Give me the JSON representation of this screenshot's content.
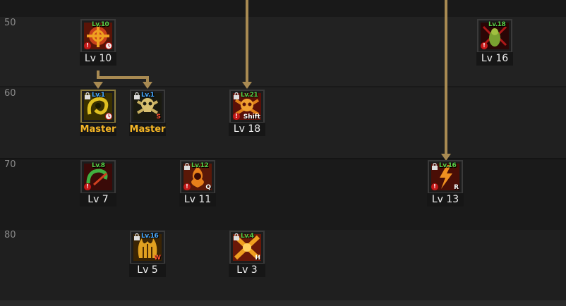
{
  "rows": [
    {
      "label": "50"
    },
    {
      "label": "60"
    },
    {
      "label": "70"
    },
    {
      "label": "80"
    }
  ],
  "skills": [
    {
      "id": "skill-a",
      "level_req": "Lv.10",
      "level_label": "Lv 10",
      "hotkey": "",
      "icon": "crosshair-skill-icon",
      "accent": "#d83a1a"
    },
    {
      "id": "skill-b",
      "level_req": "Lv.18",
      "level_label": "Lv 16",
      "hotkey": "",
      "icon": "dark-figure-skill-icon",
      "accent": "#8a1a1a"
    },
    {
      "id": "skill-c",
      "level_req": "Lv.1",
      "level_label": "Master",
      "hotkey": "",
      "icon": "swirl-skill-icon",
      "accent": "#b89a20"
    },
    {
      "id": "skill-d",
      "level_req": "Lv.1",
      "level_label": "Master",
      "hotkey": "S",
      "icon": "skull-skill-icon",
      "accent": "#b8a040"
    },
    {
      "id": "skill-e",
      "level_req": "Lv.21",
      "level_label": "Lv 18",
      "hotkey": "Shift",
      "icon": "skull-fire-skill-icon",
      "accent": "#c03a1a"
    },
    {
      "id": "skill-f",
      "level_req": "Lv.8",
      "level_label": "Lv 7",
      "hotkey": "",
      "icon": "green-swirl-skill-icon",
      "accent": "#2a8a2a"
    },
    {
      "id": "skill-g",
      "level_req": "Lv.12",
      "level_label": "Lv 11",
      "hotkey": "Q",
      "icon": "fire-figure-skill-icon",
      "accent": "#c85a1a"
    },
    {
      "id": "skill-h",
      "level_req": "Lv.16",
      "level_label": "Lv 13",
      "hotkey": "R",
      "icon": "lightning-skill-icon",
      "accent": "#d04a1a"
    },
    {
      "id": "skill-i",
      "level_req": "Lv.16",
      "level_label": "Lv 5",
      "hotkey": "W",
      "icon": "gold-flame-skill-icon",
      "accent": "#c89a20"
    },
    {
      "id": "skill-j",
      "level_req": "Lv.4",
      "level_label": "Lv 3",
      "hotkey": "H",
      "icon": "cross-burst-skill-icon",
      "accent": "#d86a1a"
    }
  ]
}
